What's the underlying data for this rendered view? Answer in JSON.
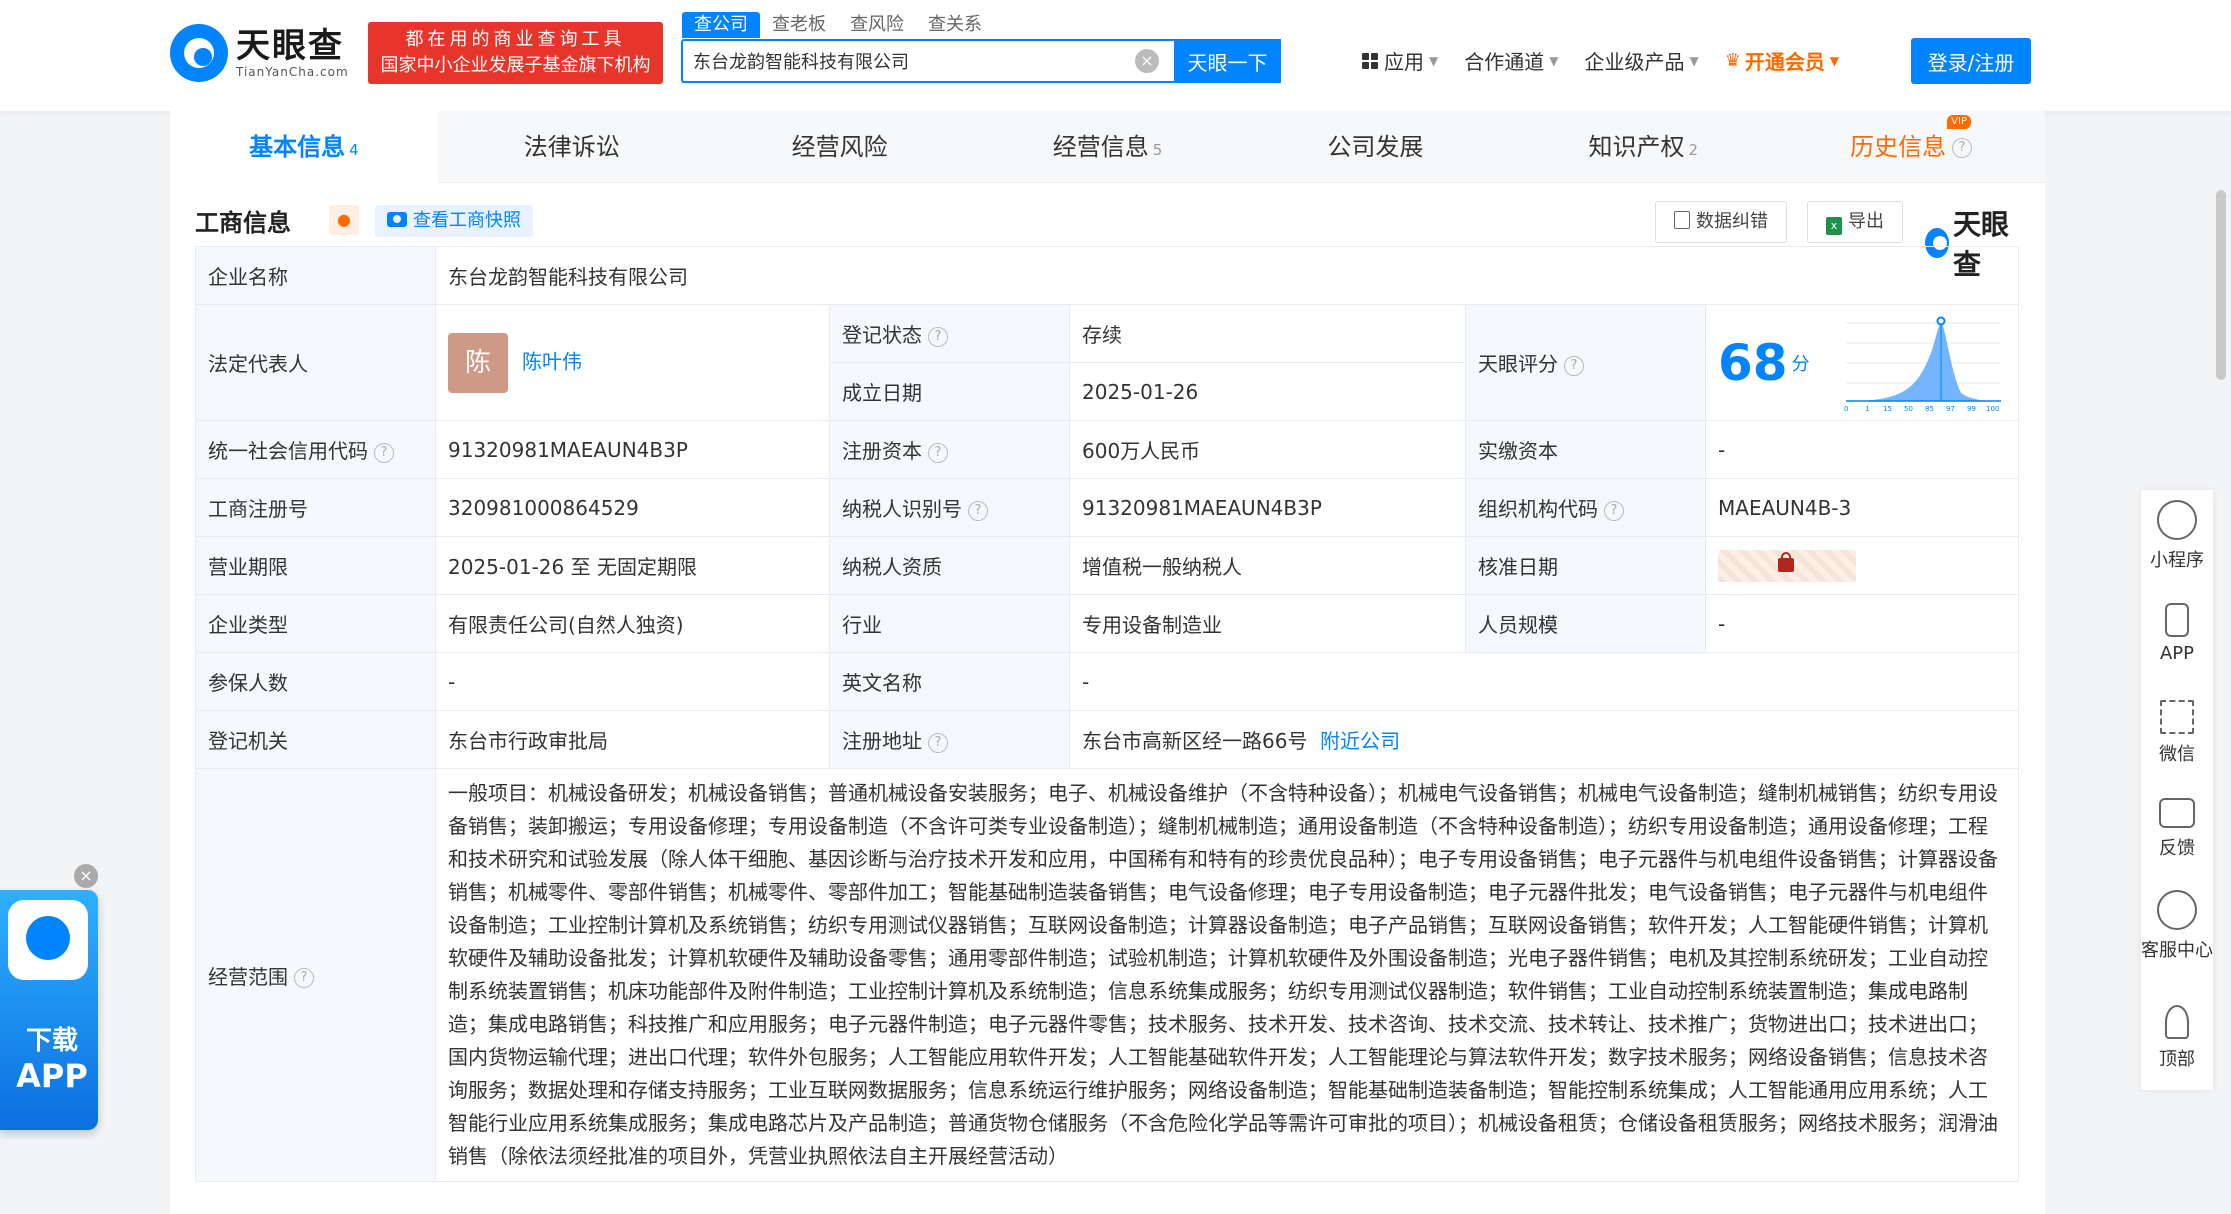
{
  "brand": {
    "name": "天眼查",
    "domain": "TianYanCha.com",
    "slogan_line1": "都在用的商业查询工具",
    "slogan_line2": "国家中小企业发展子基金旗下机构",
    "small_name": "天眼查"
  },
  "search": {
    "tabs": [
      "查公司",
      "查老板",
      "查风险",
      "查关系"
    ],
    "value": "东台龙韵智能科技有限公司",
    "clear": "×",
    "button": "天眼一下"
  },
  "topnav": {
    "apps": "应用",
    "channel": "合作通道",
    "enterprise": "企业级产品",
    "vip": "开通会员",
    "login": "登录/注册"
  },
  "tabs": [
    {
      "label": "基本信息",
      "count": "4"
    },
    {
      "label": "法律诉讼",
      "count": ""
    },
    {
      "label": "经营风险",
      "count": ""
    },
    {
      "label": "经营信息",
      "count": "5"
    },
    {
      "label": "公司发展",
      "count": ""
    },
    {
      "label": "知识产权",
      "count": "2"
    },
    {
      "label": "历史信息",
      "count": "",
      "badge": "VIP"
    }
  ],
  "section": {
    "title": "工商信息",
    "snapshot": "查看工商快照",
    "correct": "数据纠错",
    "export": "导出"
  },
  "info": {
    "company_name_label": "企业名称",
    "company_name": "东台龙韵智能科技有限公司",
    "legal_rep_label": "法定代表人",
    "legal_rep_avatar": "陈",
    "legal_rep": "陈叶伟",
    "reg_status_label": "登记状态",
    "reg_status": "存续",
    "found_date_label": "成立日期",
    "found_date": "2025-01-26",
    "score_label": "天眼评分",
    "score": "68",
    "score_unit": "分",
    "credit_code_label": "统一社会信用代码",
    "credit_code": "91320981MAEAUN4B3P",
    "reg_capital_label": "注册资本",
    "reg_capital": "600万人民币",
    "paid_capital_label": "实缴资本",
    "paid_capital": "-",
    "reg_no_label": "工商注册号",
    "reg_no": "320981000864529",
    "taxpayer_id_label": "纳税人识别号",
    "taxpayer_id": "91320981MAEAUN4B3P",
    "org_code_label": "组织机构代码",
    "org_code": "MAEAUN4B-3",
    "term_label": "营业期限",
    "term": "2025-01-26 至 无固定期限",
    "tax_qual_label": "纳税人资质",
    "tax_qual": "增值税一般纳税人",
    "approve_date_label": "核准日期",
    "type_label": "企业类型",
    "type": "有限责任公司(自然人独资)",
    "industry_label": "行业",
    "industry": "专用设备制造业",
    "staff_label": "人员规模",
    "staff": "-",
    "insured_label": "参保人数",
    "insured": "-",
    "en_name_label": "英文名称",
    "en_name": "-",
    "authority_label": "登记机关",
    "authority": "东台市行政审批局",
    "address_label": "注册地址",
    "address": "东台市高新区经一路66号",
    "nearby": "附近公司",
    "scope_label": "经营范围",
    "scope": "一般项目：机械设备研发；机械设备销售；普通机械设备安装服务；电子、机械设备维护（不含特种设备）；机械电气设备销售；机械电气设备制造；缝制机械销售；纺织专用设备销售；装卸搬运；专用设备修理；专用设备制造（不含许可类专业设备制造）；缝制机械制造；通用设备制造（不含特种设备制造）；纺织专用设备制造；通用设备修理；工程和技术研究和试验发展（除人体干细胞、基因诊断与治疗技术开发和应用，中国稀有和特有的珍贵优良品种）；电子专用设备销售；电子元器件与机电组件设备销售；计算器设备销售；机械零件、零部件销售；机械零件、零部件加工；智能基础制造装备销售；电气设备修理；电子专用设备制造；电子元器件批发；电气设备销售；电子元器件与机电组件设备制造；工业控制计算机及系统销售；纺织专用测试仪器销售；互联网设备制造；计算器设备制造；电子产品销售；互联网设备销售；软件开发；人工智能硬件销售；计算机软硬件及辅助设备批发；计算机软硬件及辅助设备零售；通用零部件制造；试验机制造；计算机软硬件及外围设备制造；光电子器件销售；电机及其控制系统研发；工业自动控制系统装置销售；机床功能部件及附件制造；工业控制计算机及系统制造；信息系统集成服务；纺织专用测试仪器制造；软件销售；工业自动控制系统装置制造；集成电路制造；集成电路销售；科技推广和应用服务；电子元器件制造；电子元器件零售；技术服务、技术开发、技术咨询、技术交流、技术转让、技术推广；货物进出口；技术进出口；国内货物运输代理；进出口代理；软件外包服务；人工智能应用软件开发；人工智能基础软件开发；人工智能理论与算法软件开发；数字技术服务；网络设备销售；信息技术咨询服务；数据处理和存储支持服务；工业互联网数据服务；信息系统运行维护服务；网络设备制造；智能基础制造装备制造；智能控制系统集成；人工智能通用应用系统；人工智能行业应用系统集成服务；集成电路芯片及产品制造；普通货物仓储服务（不含危险化学品等需许可审批的项目）；机械设备租赁；仓储设备租赁服务；网络技术服务；润滑油销售（除依法须经批准的项目外，凭营业执照依法自主开展经营活动）"
  },
  "score_chart": {
    "ticks": [
      "0",
      "1",
      "15",
      "50",
      "85",
      "97",
      "99",
      "100"
    ]
  },
  "sidebar": [
    "小程序",
    "APP",
    "微信",
    "反馈",
    "客服中心",
    "顶部"
  ],
  "app_popup": {
    "line1": "下载",
    "line2": "APP",
    "close": "×"
  },
  "colors": {
    "primary": "#0084ff",
    "vip": "#ff6a00",
    "status": "#2ca04c"
  }
}
